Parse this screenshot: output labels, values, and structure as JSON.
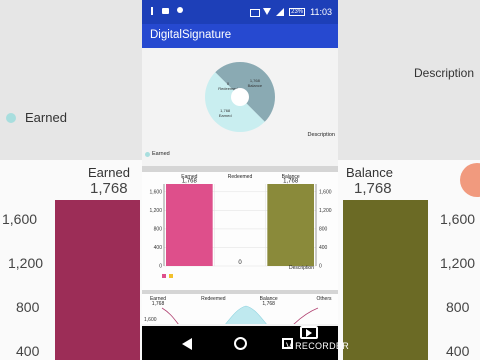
{
  "app": {
    "title": "DigitalSignature"
  },
  "status_bar": {
    "battery": "23%",
    "time": "11:03"
  },
  "pie": {
    "legend": "Earned",
    "description": "Description",
    "slices": [
      {
        "name": "Balance",
        "value": 1768,
        "label": "1,768",
        "color": "#8aaab3"
      },
      {
        "name": "Earned",
        "value": 1768,
        "label": "1,768",
        "color": "#c9eef0"
      },
      {
        "name": "Redeemed",
        "value": 0,
        "label": "0",
        "color": "#e85a8d"
      }
    ]
  },
  "chart_data": [
    {
      "type": "pie",
      "categories": [
        "Balance",
        "Earned",
        "Redeemed"
      ],
      "values": [
        1768,
        1768,
        0
      ],
      "legend": [
        "Earned"
      ],
      "description": "Description"
    },
    {
      "type": "bar",
      "categories": [
        "Earned",
        "Redeemed",
        "Balance"
      ],
      "values": [
        1768,
        0,
        1768
      ],
      "value_labels": [
        "1,768",
        "0",
        "1,768"
      ],
      "ylim": [
        0,
        1768
      ],
      "ytick_labels": [
        "0",
        "400",
        "800",
        "1,200",
        "1,600"
      ],
      "ytick_values": [
        0,
        400,
        800,
        1200,
        1600
      ],
      "colors": [
        "#de4f8b",
        "#e6e6e6",
        "#8a8a3a"
      ],
      "legend_colors": [
        "#de4f8b",
        "#f2c12e"
      ],
      "description": "Description"
    },
    {
      "type": "line",
      "categories": [
        "Earned",
        "Redeemed",
        "Balance",
        "Others"
      ],
      "value_labels": [
        "1,768",
        "",
        "1,768",
        ""
      ],
      "ytick_labels": [
        "1,600"
      ]
    }
  ],
  "background": {
    "legend": "Earned",
    "description": "Description",
    "left_col": "Earned",
    "left_val": "1,768",
    "right_col": "Balance",
    "right_val": "1,768",
    "ticks": [
      "1,600",
      "1,200",
      "800",
      "400"
    ]
  },
  "recorder": {
    "label": "V RECORDER"
  }
}
